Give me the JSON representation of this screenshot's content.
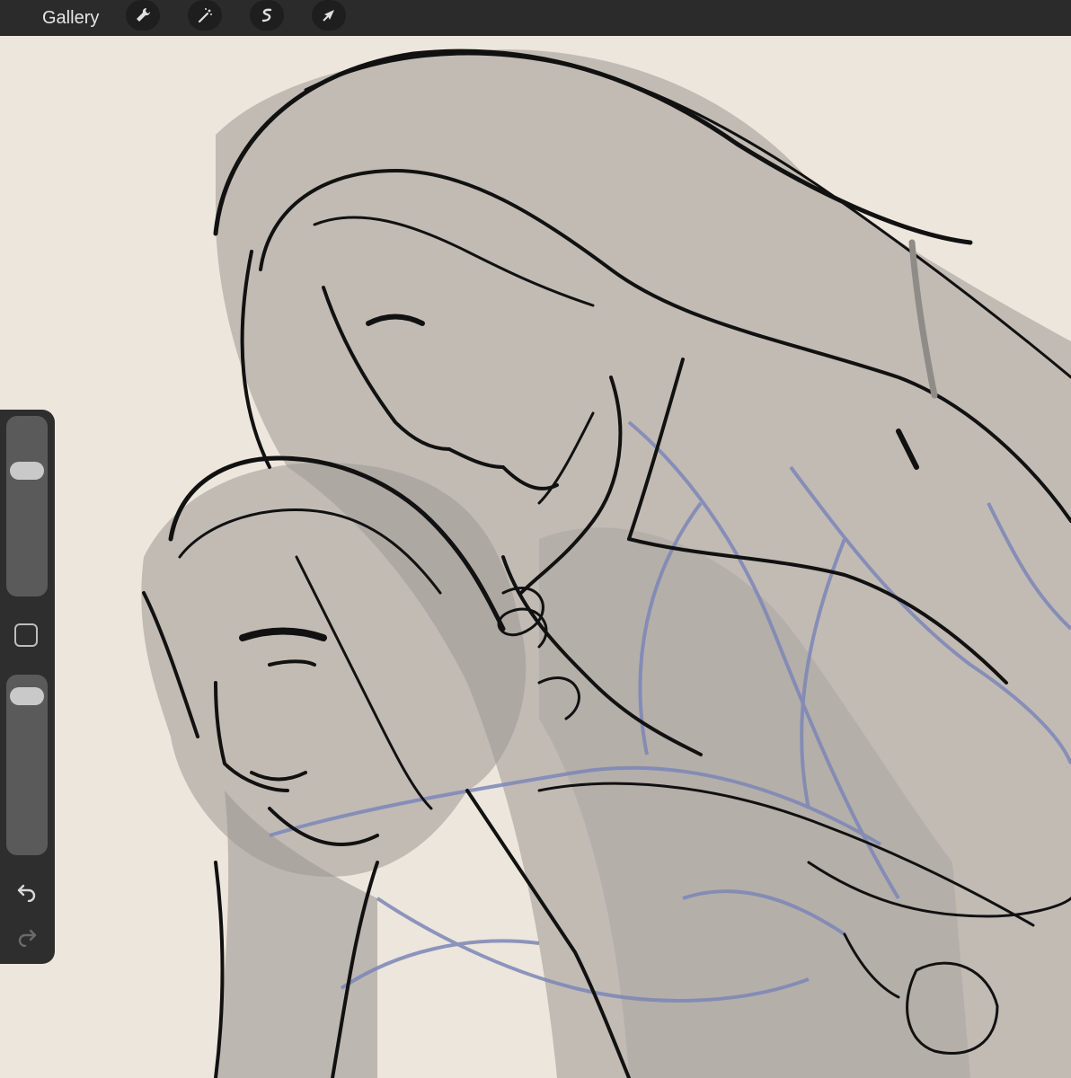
{
  "topbar": {
    "gallery_label": "Gallery",
    "tools": [
      {
        "name": "wrench-icon"
      },
      {
        "name": "magic-wand-icon"
      },
      {
        "name": "selection-icon"
      },
      {
        "name": "transform-arrow-icon"
      }
    ]
  },
  "sidebar": {
    "brush_size_level": 0.73,
    "brush_opacity_level": 0.94,
    "modify_icon": "square-icon",
    "undo_icon": "undo-icon",
    "redo_icon": "redo-icon"
  },
  "colors": {
    "topbar": "#2b2b2b",
    "canvas": "#ece6dc",
    "sidebar": "#2e2e2e",
    "ink": "#111111",
    "shade": "#8f8b87",
    "sketch_blue": "#7c86b8"
  }
}
